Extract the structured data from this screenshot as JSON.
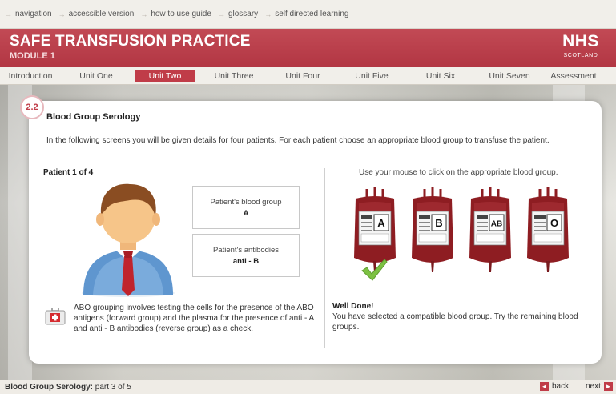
{
  "topnav": {
    "links": [
      "navigation",
      "accessible version",
      "how to use guide",
      "glossary",
      "self directed learning"
    ]
  },
  "header": {
    "title": "SAFE TRANSFUSION PRACTICE",
    "subtitle": "MODULE 1",
    "logo_main": "NHS",
    "logo_sub": "SCOTLAND"
  },
  "tabs": [
    "Introduction",
    "Unit One",
    "Unit Two",
    "Unit Three",
    "Unit Four",
    "Unit Five",
    "Unit Six",
    "Unit Seven",
    "Assessment"
  ],
  "active_tab": "Unit Two",
  "panel": {
    "badge": "2.2",
    "title": "Blood Group Serology",
    "intro": "In the following screens you will be given details for four patients. For each patient choose an appropriate blood group to transfuse the patient.",
    "patient_label": "Patient 1 of 4",
    "blood_group_label": "Patient's blood group",
    "blood_group_value": "A",
    "antibodies_label": "Patient's antibodies",
    "antibodies_value": "anti - B",
    "instruction": "Use your mouse to click on the appropriate blood group.",
    "bags": [
      "A",
      "B",
      "AB",
      "O"
    ],
    "selected_bag": "A",
    "success_title": "Well Done!",
    "success_text": "You have selected a compatible blood group. Try the remaining blood groups.",
    "note": "ABO grouping involves testing the cells for the presence of the ABO antigens (forward group) and the plasma for the presence of anti - A and anti - B antibodies (reverse group) as a check."
  },
  "footer": {
    "section": "Blood Group Serology:",
    "part": "part 3 of 5",
    "back": "back",
    "next": "next"
  },
  "colors": {
    "brand_red": "#c03c48",
    "blood": "#8e1d22",
    "check_green": "#7cc142"
  }
}
